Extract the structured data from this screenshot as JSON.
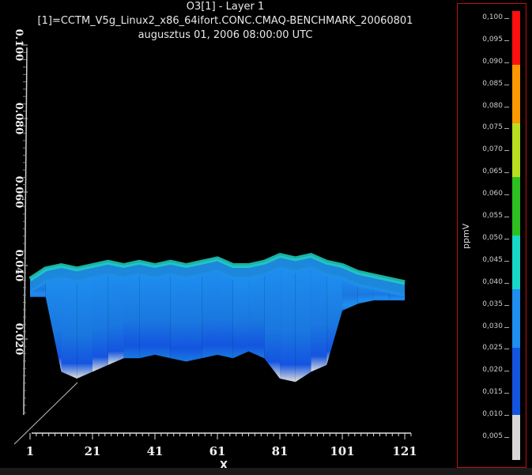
{
  "title": {
    "line1": "O3[1] - Layer 1",
    "line2": "[1]=CCTM_V5g_Linux2_x86_64ifort.CONC.CMAQ-BENCHMARK_20060801",
    "line3": "augusztus 01, 2006 08:00:00 UTC"
  },
  "chart_data": {
    "type": "area",
    "xlabel": "X",
    "ylabel": "",
    "x_ticks": [
      "1",
      "21",
      "41",
      "61",
      "81",
      "101",
      "121"
    ],
    "y_ticks": [
      "0.020",
      "0.040",
      "0.060",
      "0.080",
      "0.100"
    ],
    "xlim": [
      1,
      124
    ],
    "ylim": [
      0,
      0.1
    ],
    "surface_top_ppmv": [
      [
        1,
        0.036
      ],
      [
        6,
        0.039
      ],
      [
        11,
        0.04
      ],
      [
        16,
        0.039
      ],
      [
        21,
        0.04
      ],
      [
        26,
        0.041
      ],
      [
        31,
        0.04
      ],
      [
        36,
        0.041
      ],
      [
        41,
        0.04
      ],
      [
        46,
        0.041
      ],
      [
        51,
        0.04
      ],
      [
        56,
        0.041
      ],
      [
        61,
        0.042
      ],
      [
        66,
        0.04
      ],
      [
        71,
        0.04
      ],
      [
        76,
        0.041
      ],
      [
        81,
        0.043
      ],
      [
        86,
        0.042
      ],
      [
        91,
        0.043
      ],
      [
        96,
        0.041
      ],
      [
        101,
        0.04
      ],
      [
        106,
        0.038
      ],
      [
        111,
        0.037
      ],
      [
        116,
        0.036
      ],
      [
        121,
        0.035
      ]
    ],
    "surface_bottom_ppmv": [
      [
        1,
        0.034
      ],
      [
        6,
        0.034
      ],
      [
        11,
        0.012
      ],
      [
        16,
        0.01
      ],
      [
        21,
        0.012
      ],
      [
        26,
        0.014
      ],
      [
        31,
        0.016
      ],
      [
        36,
        0.016
      ],
      [
        41,
        0.017
      ],
      [
        46,
        0.016
      ],
      [
        51,
        0.015
      ],
      [
        56,
        0.016
      ],
      [
        61,
        0.017
      ],
      [
        66,
        0.016
      ],
      [
        71,
        0.018
      ],
      [
        76,
        0.016
      ],
      [
        81,
        0.01
      ],
      [
        86,
        0.009
      ],
      [
        91,
        0.012
      ],
      [
        96,
        0.014
      ],
      [
        101,
        0.03
      ],
      [
        106,
        0.032
      ],
      [
        111,
        0.033
      ],
      [
        116,
        0.033
      ],
      [
        121,
        0.033
      ]
    ]
  },
  "legend": {
    "unit": "ppmV",
    "ticks": [
      "0,100",
      "0,095",
      "0,090",
      "0,085",
      "0,080",
      "0,075",
      "0,070",
      "0,065",
      "0,060",
      "0,055",
      "0,050",
      "0,045",
      "0,040",
      "0,035",
      "0,030",
      "0,025",
      "0,020",
      "0,015",
      "0,010",
      "0,005"
    ],
    "color_bins": [
      {
        "from": 0.0,
        "to": 0.01,
        "color": "#d8d8d8"
      },
      {
        "from": 0.01,
        "to": 0.025,
        "color": "#1455e0"
      },
      {
        "from": 0.025,
        "to": 0.038,
        "color": "#1e8ef0"
      },
      {
        "from": 0.038,
        "to": 0.05,
        "color": "#18d8c8"
      },
      {
        "from": 0.05,
        "to": 0.063,
        "color": "#2ec020"
      },
      {
        "from": 0.063,
        "to": 0.075,
        "color": "#b8e020"
      },
      {
        "from": 0.075,
        "to": 0.088,
        "color": "#ff9800"
      },
      {
        "from": 0.088,
        "to": 0.1,
        "color": "#ff1010"
      }
    ]
  }
}
